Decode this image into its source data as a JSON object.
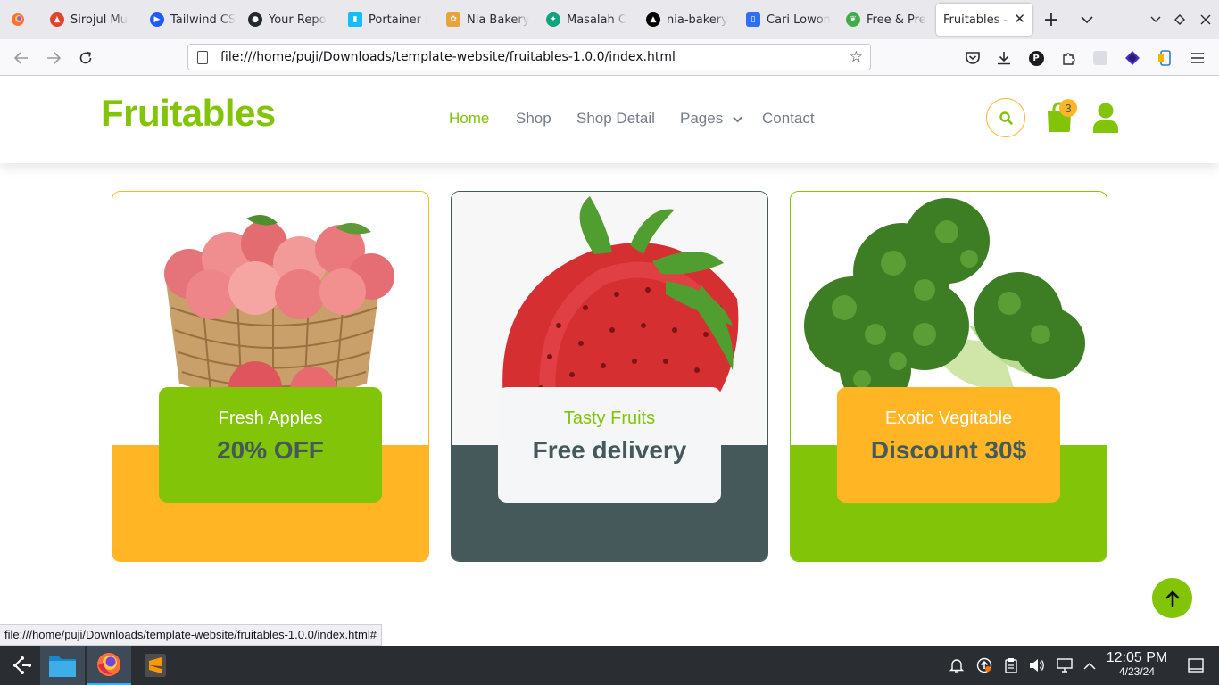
{
  "browser": {
    "tabs": [
      {
        "title": "Sirojul Mu",
        "icon": "gitlab-icon",
        "color": "#e2432a"
      },
      {
        "title": "Tailwind CS",
        "icon": "play-icon",
        "color": "#1f5bff"
      },
      {
        "title": "Your Repo",
        "icon": "github-icon",
        "color": "#24292f"
      },
      {
        "title": "Portainer |",
        "icon": "portainer-icon",
        "color": "#13bef9"
      },
      {
        "title": "Nia Bakery",
        "icon": "bakery-icon",
        "color": "#e8a33c"
      },
      {
        "title": "Masalah C",
        "icon": "chatgpt-icon",
        "color": "#10a37f"
      },
      {
        "title": "nia-bakery",
        "icon": "vercel-icon",
        "color": "#000000"
      },
      {
        "title": "Cari Lowon",
        "icon": "job-icon",
        "color": "#2d6ff5"
      },
      {
        "title": "Free & Pre",
        "icon": "leaf-icon",
        "color": "#3fae49"
      },
      {
        "title": "Fruitables - V",
        "icon": "",
        "active": true
      }
    ],
    "url": "file:///home/puji/Downloads/template-website/fruitables-1.0.0/index.html",
    "status_url": "file:///home/puji/Downloads/template-website/fruitables-1.0.0/index.html#"
  },
  "site": {
    "brand": "Fruitables",
    "menu": {
      "home": "Home",
      "shop": "Shop",
      "shop_detail": "Shop Detail",
      "pages": "Pages",
      "contact": "Contact"
    },
    "cart_count": "3",
    "colors": {
      "primary": "#81c408",
      "secondary": "#ffb524",
      "dark": "#45595b"
    }
  },
  "cards": [
    {
      "subtitle": "Fresh Apples",
      "highlight": "20% OFF",
      "image": "apple-basket-image"
    },
    {
      "subtitle": "Tasty Fruits",
      "highlight": "Free delivery",
      "image": "strawberry-image"
    },
    {
      "subtitle": "Exotic Vegitable",
      "highlight": "Discount 30$",
      "image": "broccoli-image"
    }
  ],
  "taskbar": {
    "time": "12:05 PM",
    "date": "4/23/24"
  }
}
